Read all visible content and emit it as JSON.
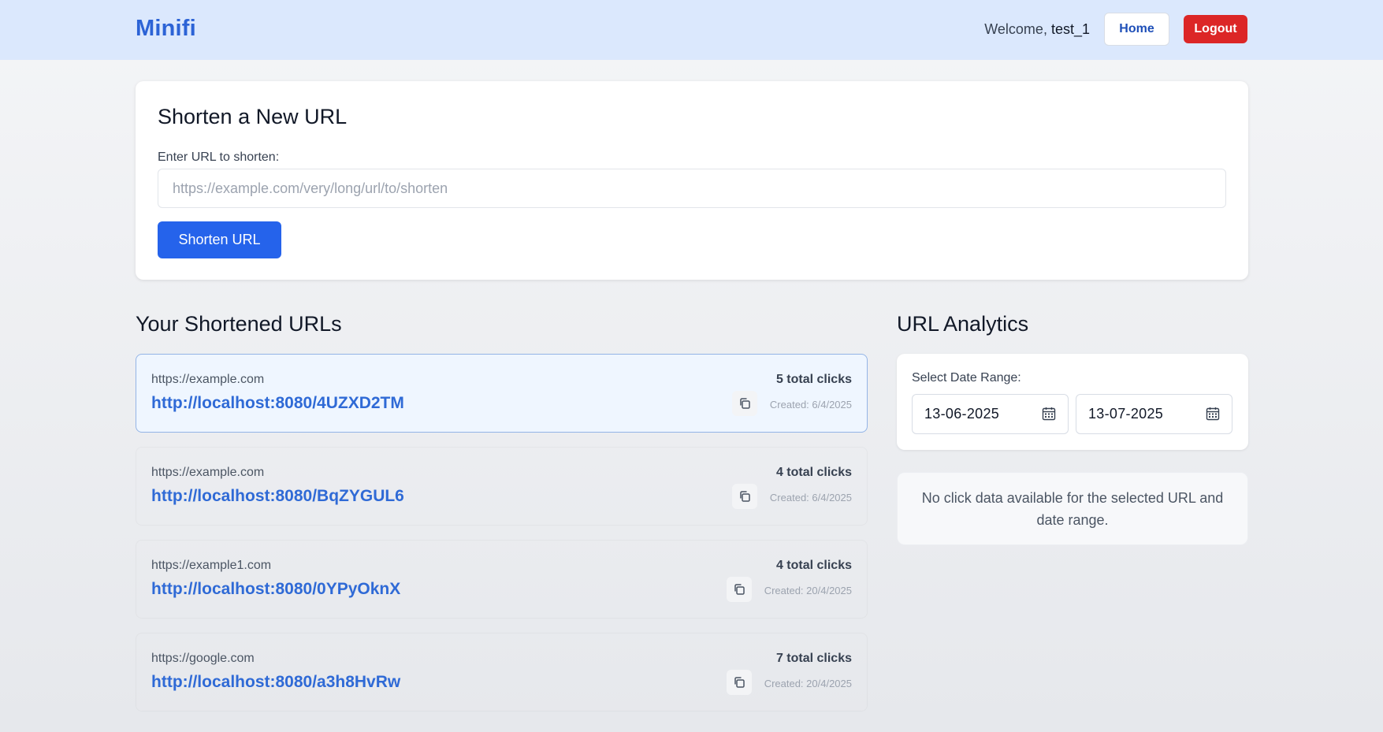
{
  "header": {
    "brand": "Minifi",
    "welcome_prefix": "Welcome, ",
    "username": "test_1",
    "home_label": "Home",
    "logout_label": "Logout"
  },
  "shorten": {
    "title": "Shorten a New URL",
    "input_label": "Enter URL to shorten:",
    "input_value": "",
    "input_placeholder": "https://example.com/very/long/url/to/shorten",
    "button_label": "Shorten URL"
  },
  "urls": {
    "title": "Your Shortened URLs",
    "items": [
      {
        "original": "https://example.com",
        "short": "http://localhost:8080/4UZXD2TM",
        "clicks": "5 total clicks",
        "created": "Created: 6/4/2025",
        "selected": true
      },
      {
        "original": "https://example.com",
        "short": "http://localhost:8080/BqZYGUL6",
        "clicks": "4 total clicks",
        "created": "Created: 6/4/2025",
        "selected": false
      },
      {
        "original": "https://example1.com",
        "short": "http://localhost:8080/0YPyOknX",
        "clicks": "4 total clicks",
        "created": "Created: 20/4/2025",
        "selected": false
      },
      {
        "original": "https://google.com",
        "short": "http://localhost:8080/a3h8HvRw",
        "clicks": "7 total clicks",
        "created": "Created: 20/4/2025",
        "selected": false
      }
    ]
  },
  "analytics": {
    "title": "URL Analytics",
    "range_label": "Select Date Range:",
    "start_date": "13-06-2025",
    "end_date": "13-07-2025",
    "empty_message": "No click data available for the selected URL and date range."
  },
  "icons": {
    "copy": "copy-icon",
    "calendar": "calendar-icon"
  },
  "colors": {
    "brand": "#2c63d6",
    "primary": "#2563eb",
    "danger": "#dc2626",
    "header_bg": "#dbe8fd",
    "link": "#2f6ad6"
  }
}
